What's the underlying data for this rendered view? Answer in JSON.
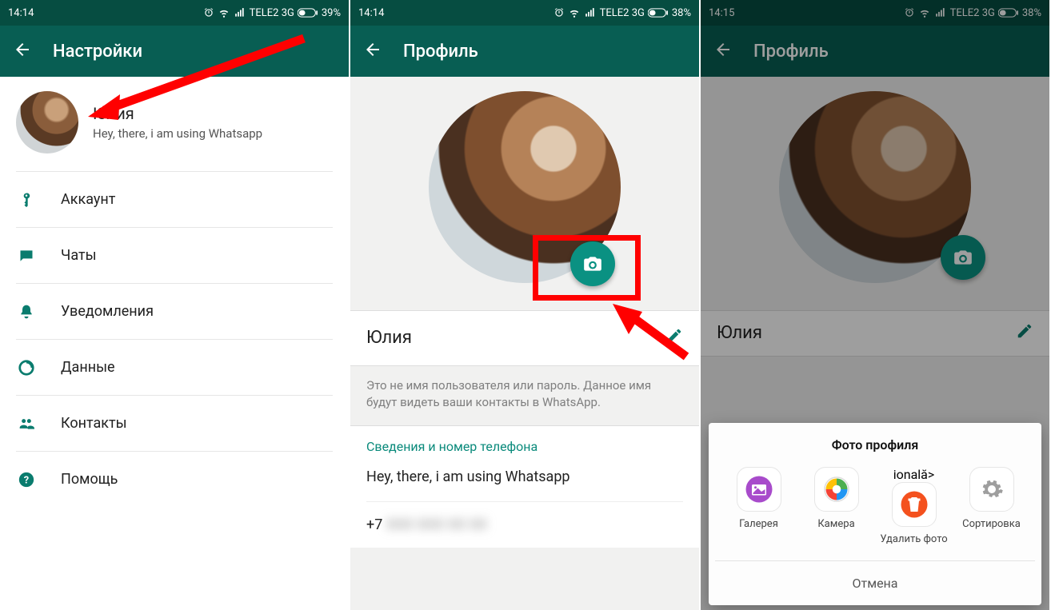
{
  "status": {
    "s1": {
      "time": "14:14",
      "carrier": "TELE2 3G",
      "battery": "39%"
    },
    "s2": {
      "time": "14:14",
      "carrier": "TELE2 3G",
      "battery": "38%"
    },
    "s3": {
      "time": "14:15",
      "carrier": "TELE2 3G",
      "battery": "38%"
    }
  },
  "screen1": {
    "title": "Настройки",
    "profile": {
      "name": "Юлия",
      "status": "Hey, there, i am using Whatsapp"
    },
    "menu": {
      "account": "Аккаунт",
      "chats": "Чаты",
      "notifications": "Уведомления",
      "data": "Данные",
      "contacts": "Контакты",
      "help": "Помощь"
    }
  },
  "screen2": {
    "title": "Профиль",
    "name": "Юлия",
    "hint": "Это не имя пользователя или пароль. Данное имя будут видеть ваши контакты в WhatsApp.",
    "info_heading": "Сведения и номер телефона",
    "status_text": "Hey, there, i am using Whatsapp",
    "phone_prefix": "+7",
    "phone_masked": "XXX XXX XX XX"
  },
  "screen3": {
    "title": "Профиль",
    "name": "Юлия",
    "sheet": {
      "title": "Фото профиля",
      "options": {
        "gallery": "Галерея",
        "camera": "Камера",
        "delete": "Удалить фото",
        "sort": "Сортировка"
      },
      "cancel": "Отмена"
    }
  }
}
